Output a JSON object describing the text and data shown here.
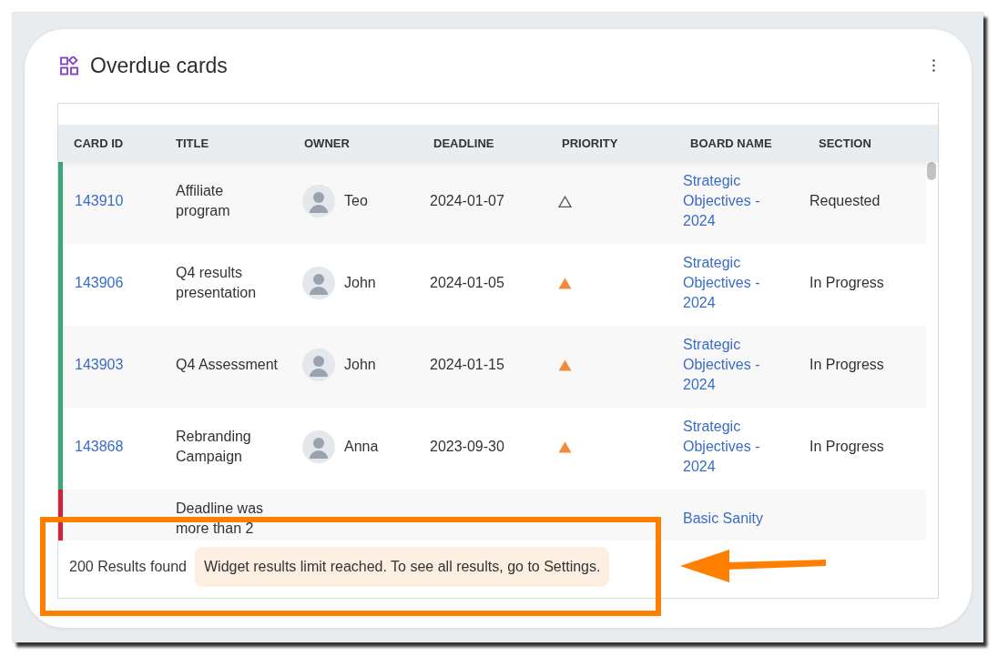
{
  "widget": {
    "title": "Overdue cards"
  },
  "table": {
    "columns": [
      "CARD ID",
      "TITLE",
      "OWNER",
      "DEADLINE",
      "PRIORITY",
      "BOARD NAME",
      "SECTION"
    ],
    "rows": [
      {
        "color": "#3aa87b",
        "card_id": "143910",
        "title": "Affiliate program",
        "owner": "Teo",
        "deadline": "2024-01-07",
        "priority_filled": false,
        "board_name": "Strategic Objectives - 2024",
        "section": "Requested"
      },
      {
        "color": "#3aa87b",
        "card_id": "143906",
        "title": "Q4 results presentation",
        "owner": "John",
        "deadline": "2024-01-05",
        "priority_filled": true,
        "board_name": "Strategic Objectives - 2024",
        "section": "In Progress"
      },
      {
        "color": "#3aa87b",
        "card_id": "143903",
        "title": "Q4 Assessment",
        "owner": "John",
        "deadline": "2024-01-15",
        "priority_filled": true,
        "board_name": "Strategic Objectives - 2024",
        "section": "In Progress"
      },
      {
        "color": "#3aa87b",
        "card_id": "143868",
        "title": "Rebranding Campaign",
        "owner": "Anna",
        "deadline": "2023-09-30",
        "priority_filled": true,
        "board_name": "Strategic Objectives - 2024",
        "section": "In Progress"
      },
      {
        "color": "#d0233c",
        "title": "Deadline was more than 2",
        "board_name": "Basic Sanity"
      }
    ]
  },
  "footer": {
    "results": "200 Results found",
    "notice": "Widget results limit reached. To see all results, go to Settings."
  }
}
